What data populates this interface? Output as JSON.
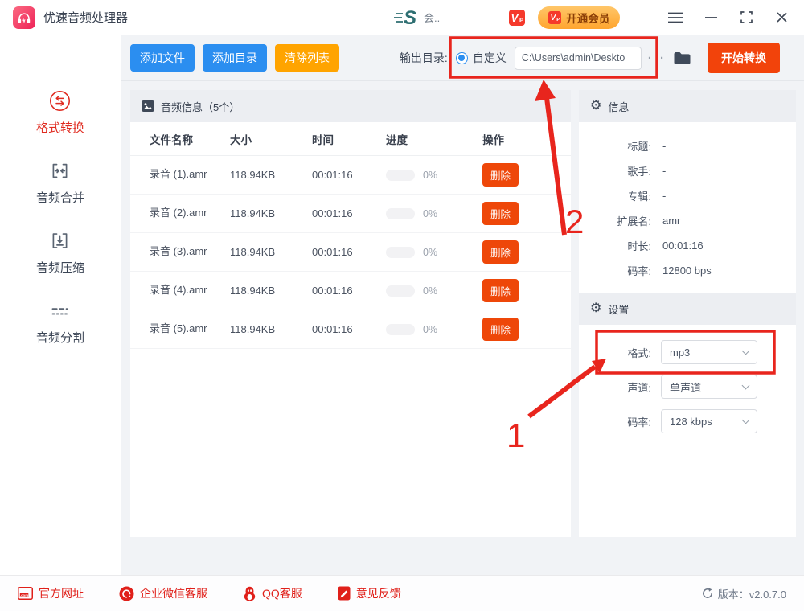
{
  "titlebar": {
    "app_name": "优速音频处理器",
    "center_text": "会..",
    "vip_v": "V",
    "vip_ip": "IP",
    "vip_button_label": "开通会员"
  },
  "toolbar": {
    "add_file_label": "添加文件",
    "add_dir_label": "添加目录",
    "clear_list_label": "清除列表",
    "output_dir_label": "输出目录:",
    "custom_radio_label": "自定义",
    "output_path": "C:\\Users\\admin\\Deskto",
    "path_dots": "· ·",
    "start_button_label": "开始转换"
  },
  "sidebar": {
    "items": [
      {
        "label": "格式转换",
        "active": true
      },
      {
        "label": "音频合并",
        "active": false
      },
      {
        "label": "音频压缩",
        "active": false
      },
      {
        "label": "音频分割",
        "active": false
      }
    ]
  },
  "table": {
    "header_title": "音频信息（5个）",
    "columns": [
      "文件名称",
      "大小",
      "时间",
      "进度",
      "操作"
    ],
    "delete_label": "删除",
    "rows": [
      {
        "name": "录音 (1).amr",
        "size": "118.94KB",
        "time": "00:01:16",
        "progress": "0%"
      },
      {
        "name": "录音 (2).amr",
        "size": "118.94KB",
        "time": "00:01:16",
        "progress": "0%"
      },
      {
        "name": "录音 (3).amr",
        "size": "118.94KB",
        "time": "00:01:16",
        "progress": "0%"
      },
      {
        "name": "录音 (4).amr",
        "size": "118.94KB",
        "time": "00:01:16",
        "progress": "0%"
      },
      {
        "name": "录音 (5).amr",
        "size": "118.94KB",
        "time": "00:01:16",
        "progress": "0%"
      }
    ]
  },
  "info": {
    "title": "信息",
    "fields": [
      {
        "label": "标题:",
        "value": "-"
      },
      {
        "label": "歌手:",
        "value": "-"
      },
      {
        "label": "专辑:",
        "value": "-"
      },
      {
        "label": "扩展名:",
        "value": "amr"
      },
      {
        "label": "时长:",
        "value": "00:01:16"
      },
      {
        "label": "码率:",
        "value": "12800 bps"
      }
    ]
  },
  "settings": {
    "title": "设置",
    "fields": [
      {
        "label": "格式:",
        "value": "mp3"
      },
      {
        "label": "声道:",
        "value": "单声道"
      },
      {
        "label": "码率:",
        "value": "128 kbps"
      }
    ]
  },
  "footer": {
    "links": [
      "官方网址",
      "企业微信客服",
      "QQ客服",
      "意见反馈"
    ],
    "version": "版本：v2.0.7.0"
  },
  "annotations": {
    "step1": "1",
    "step2": "2"
  },
  "colors": {
    "primary_blue": "#2b8ef0",
    "accent_orange": "#ffa400",
    "action_red": "#f2430b",
    "delete_red": "#ee4709",
    "annotation_red": "#e8251d",
    "active_nav_red": "#e02b20",
    "footer_red": "#e0201a",
    "vip_gold": "#ffb545"
  }
}
